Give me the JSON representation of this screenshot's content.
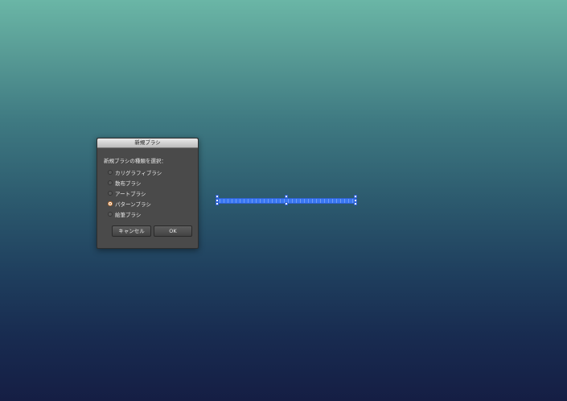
{
  "dialog": {
    "title": "新規ブラシ",
    "prompt": "新規ブラシの種類を選択：",
    "options": [
      {
        "label": "カリグラフィブラシ",
        "checked": false
      },
      {
        "label": "散布ブラシ",
        "checked": false
      },
      {
        "label": "アートブラシ",
        "checked": false
      },
      {
        "label": "パターンブラシ",
        "checked": true
      },
      {
        "label": "絵筆ブラシ",
        "checked": false
      }
    ],
    "cancel_label": "キャンセル",
    "ok_label": "OK"
  },
  "colors": {
    "selection": "#2f62d4",
    "brush_fill": "#3a78f2",
    "radio_selected": "#c4722a"
  }
}
